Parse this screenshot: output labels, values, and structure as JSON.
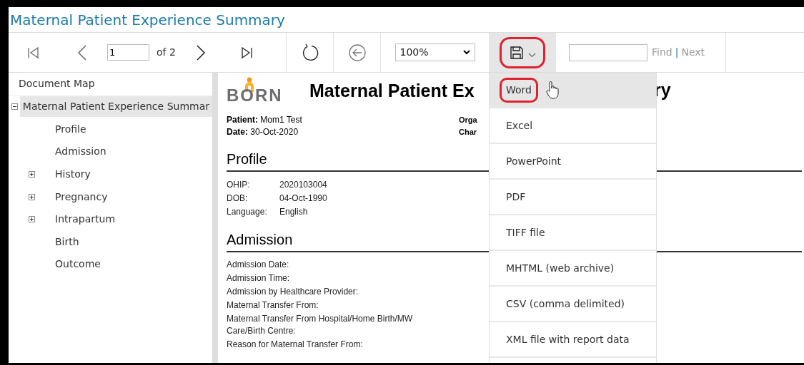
{
  "window": {
    "title": "Maternal Patient Experience Summary"
  },
  "toolbar": {
    "page": "1",
    "page_count": "of 2",
    "zoom": "100%",
    "find": "Find",
    "find_separator": "|",
    "next": "Next",
    "export_open": true
  },
  "export_menu": [
    {
      "label": "Word",
      "selected": true
    },
    {
      "label": "Excel",
      "selected": false
    },
    {
      "label": "PowerPoint",
      "selected": false
    },
    {
      "label": "PDF",
      "selected": false
    },
    {
      "label": "TIFF file",
      "selected": false
    },
    {
      "label": "MHTML (web archive)",
      "selected": false
    },
    {
      "label": "CSV (comma delimited)",
      "selected": false
    },
    {
      "label": "XML file with report data",
      "selected": false
    }
  ],
  "document_map": {
    "title": "Document Map",
    "items": [
      {
        "label": "Maternal Patient Experience Summar",
        "expanded": true,
        "selected": true,
        "children": [
          {
            "label": "Profile",
            "selected": false
          },
          {
            "label": "Admission",
            "selected": false
          },
          {
            "label": "History",
            "expanded": false,
            "selected": false
          },
          {
            "label": "Pregnancy",
            "expanded": false,
            "selected": false
          },
          {
            "label": "Intrapartum",
            "expanded": false,
            "selected": false
          },
          {
            "label": "Birth",
            "selected": false
          },
          {
            "label": "Outcome",
            "selected": false
          }
        ]
      }
    ]
  },
  "report": {
    "logo": "BORN",
    "title": "Maternal Patient Ex",
    "title_end": "ry",
    "patient_label": "Patient:",
    "patient": "Mom1 Test",
    "date_label": "Date:",
    "date": "30-Oct-2020",
    "right_labels": [
      "Orga",
      "Char"
    ],
    "sections": [
      {
        "heading": "Profile",
        "kind": "compact",
        "rows": [
          {
            "label": "OHIP:",
            "value": "2020103004"
          },
          {
            "label": "DOB:",
            "value": "04-Oct-1990"
          },
          {
            "label": "Language:",
            "value": "English"
          }
        ]
      },
      {
        "heading": "Admission",
        "kind": "wide",
        "rows": [
          {
            "label": "Admission Date:"
          },
          {
            "label": "Admission Time:"
          },
          {
            "label": "Admission by Healthcare Provider:"
          },
          {
            "label": "Maternal Transfer From:"
          },
          {
            "label": "Maternal Transfer From Hospital/Home Birth/MW Care/Birth Centre:"
          },
          {
            "label": "Reason for Maternal Transfer From:"
          }
        ]
      }
    ]
  }
}
